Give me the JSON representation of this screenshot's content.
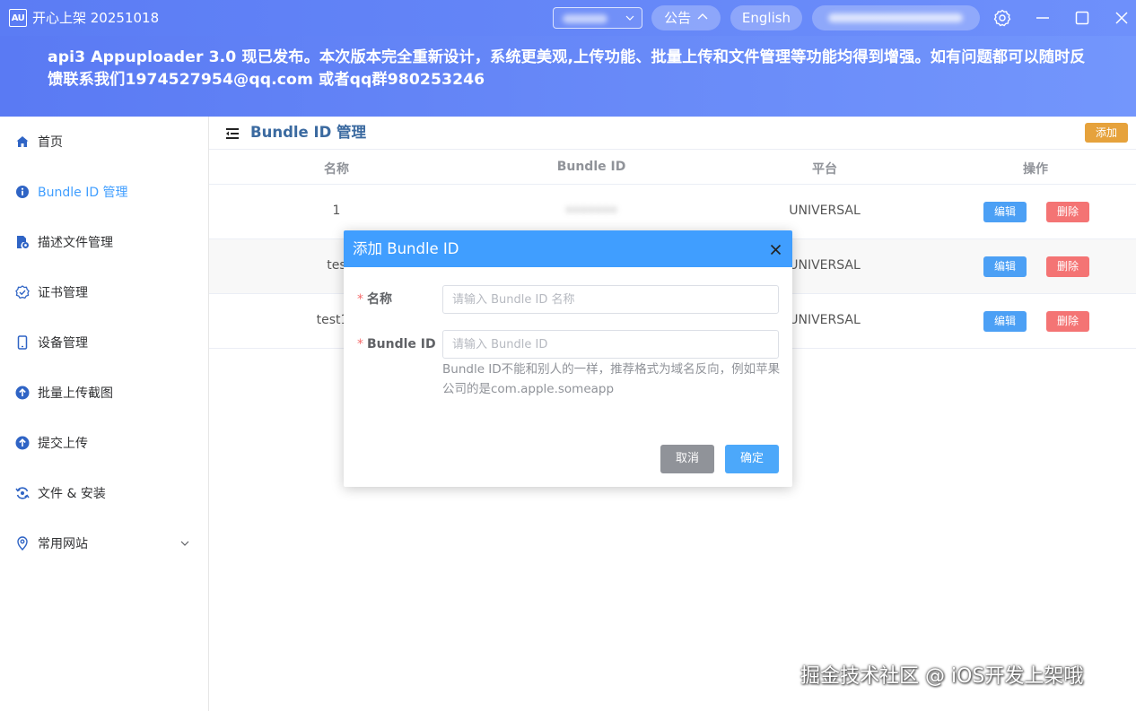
{
  "app": {
    "logo_text": "AU",
    "title": "开心上架 20251018"
  },
  "titlebar": {
    "notice_label": "公告",
    "language_label": "English"
  },
  "banner": {
    "text": "api3 Appuploader 3.0 现已发布。本次版本完全重新设计，系统更美观,上传功能、批量上传和文件管理等功能均得到增强。如有问题都可以随时反馈联系我们1974527954@qq.com 或者qq群980253246"
  },
  "sidebar": {
    "items": [
      {
        "label": "首页",
        "icon": "home-icon"
      },
      {
        "label": "Bundle ID 管理",
        "icon": "info-icon"
      },
      {
        "label": "描述文件管理",
        "icon": "file-gear-icon"
      },
      {
        "label": "证书管理",
        "icon": "badge-check-icon"
      },
      {
        "label": "设备管理",
        "icon": "phone-icon"
      },
      {
        "label": "批量上传截图",
        "icon": "upload-icon"
      },
      {
        "label": "提交上传",
        "icon": "upload-icon"
      },
      {
        "label": "文件 & 安装",
        "icon": "sync-icon"
      },
      {
        "label": "常用网站",
        "icon": "location-icon"
      }
    ],
    "active_index": 1
  },
  "main": {
    "title": "Bundle ID 管理",
    "add_label": "添加",
    "table": {
      "headers": [
        "名称",
        "Bundle ID",
        "平台",
        "操作"
      ],
      "rows": [
        {
          "name": "1",
          "bundle_id": "•••••••",
          "platform": "UNIVERSAL"
        },
        {
          "name": "tes",
          "bundle_id": "",
          "platform": "UNIVERSAL"
        },
        {
          "name": "test11",
          "bundle_id": "",
          "platform": "UNIVERSAL"
        }
      ],
      "edit_label": "编辑",
      "delete_label": "删除"
    }
  },
  "modal": {
    "title": "添加 Bundle ID",
    "name_label": "名称",
    "name_placeholder": "请输入 Bundle ID 名称",
    "bundle_label": "Bundle ID",
    "bundle_placeholder": "请输入 Bundle ID",
    "bundle_help": "Bundle ID不能和别人的一样，推荐格式为域名反向，例如苹果公司的是com.apple.someapp",
    "cancel_label": "取消",
    "confirm_label": "确定"
  },
  "watermark": "掘金技术社区 @ iOS开发上架哦",
  "colors": {
    "primary": "#409eff",
    "header_gradient_start": "#5b7cf4",
    "warning": "#e6a23c",
    "danger": "#f47474"
  }
}
